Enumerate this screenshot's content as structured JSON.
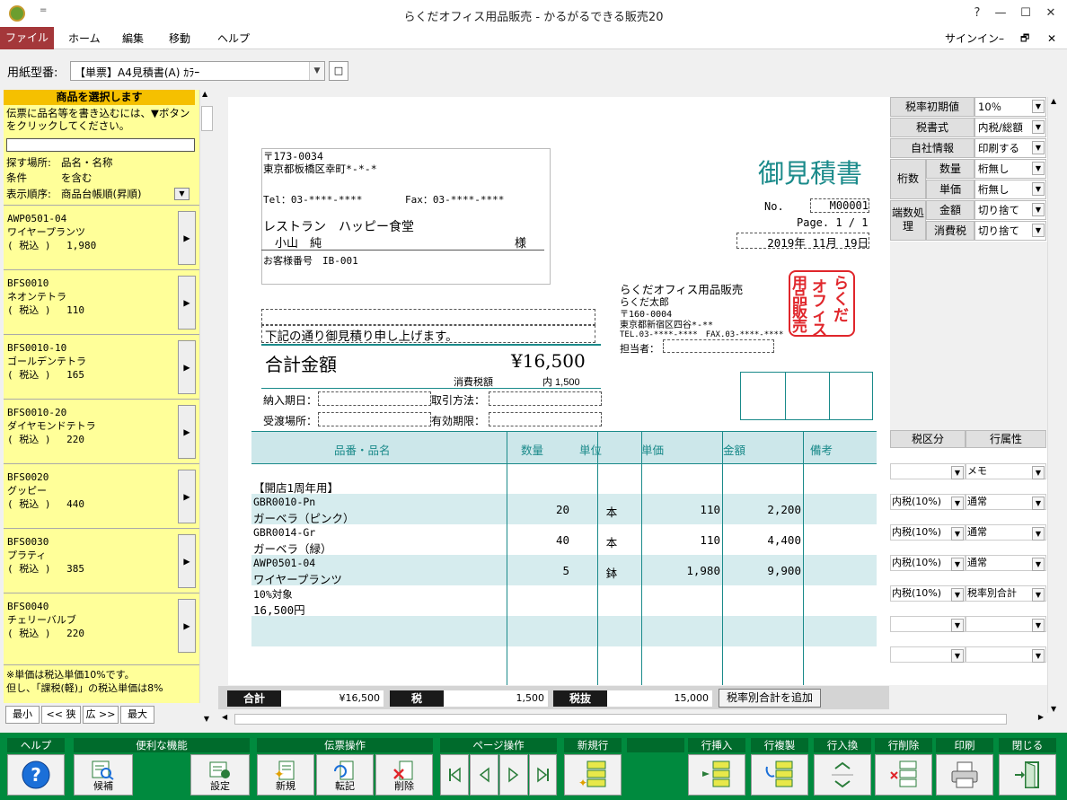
{
  "window": {
    "title": "らくだオフィス用品販売 - かるがるできる販売20",
    "help": "?",
    "min": "—",
    "max": "☐",
    "close": "✕",
    "qat": "="
  },
  "ribbon": {
    "file": "ファイル",
    "tabs": [
      "ホーム",
      "編集",
      "移動",
      "ヘルプ"
    ],
    "signin": "サインイン",
    "min": "–",
    "restore": "🗗",
    "close": "✕"
  },
  "toolbar": {
    "label": "用紙型番:",
    "form_value": "【単票】A4見積書(A) ｶﾗｰ",
    "btn": "□"
  },
  "left": {
    "header": "商品を選択します",
    "instruction": "伝票に品名等を書き込むには、▼ボタンをクリックしてください。",
    "search_value": "",
    "place_label": "探す場所:",
    "place_value": "品名・名称",
    "cond_label": "条件",
    "cond_value": "を含む",
    "order_label": "表示順序:",
    "order_value": "商品台帳順(昇順)",
    "items": [
      {
        "code": "AWP0501-04",
        "name": "ワイヤープランツ",
        "price": "( 税込 )　 1,980"
      },
      {
        "code": "BFS0010",
        "name": "ネオンテトラ",
        "price": "( 税込 )　 110"
      },
      {
        "code": "BFS0010-10",
        "name": "ゴールデンテトラ",
        "price": "( 税込 )　 165"
      },
      {
        "code": "BFS0010-20",
        "name": "ダイヤモンドテトラ",
        "price": "( 税込 )　 220"
      },
      {
        "code": "BFS0020",
        "name": "グッピー",
        "price": "( 税込 )　 440"
      },
      {
        "code": "BFS0030",
        "name": "プラティ",
        "price": "( 税込 )　 385"
      },
      {
        "code": "BFS0040",
        "name": "チェリーバルブ",
        "price": "( 税込 )　 220"
      }
    ],
    "note1": "※単価は税込単価10%です。",
    "note2": "但し、「課税(軽)」の税込単価は8%",
    "btns": [
      "最小",
      "<< 狭",
      "広 >>",
      "最大"
    ]
  },
  "doc": {
    "zip": "〒173-0034",
    "addr": "東京都板橋区幸町*-*-*",
    "tel": "Tel：03-****-****",
    "fax": "Fax：03-****-****",
    "customer": "レストラン　ハッピー食堂",
    "person": "小山　純",
    "sama": "様",
    "custno": "お客様番号　IB-001",
    "title": "御見積書",
    "no_label": "No.",
    "no_value": "M00001",
    "page": "Page. 1 / 1",
    "date": "2019年 11月 19日",
    "co_name": "らくだオフィス用品販売",
    "co_person": "らくだ太郎",
    "co_zip": "〒160-0004",
    "co_addr": "東京都新宿区四谷*-**",
    "co_tel": "TEL.03-****-****　FAX.03-****-****",
    "tanto": "担当者：",
    "stamp": [
      "用",
      "品",
      "販",
      "売",
      "オ",
      "フ",
      "ィ",
      "ス",
      "ら",
      "く",
      "だ"
    ],
    "lead": "下記の通り御見積り申し上げます。",
    "total_label": "合計金額",
    "total_value": "¥16,500",
    "tax_label": "消費税額",
    "tax_value": "内 1,500",
    "delivery": "納入期日：",
    "payment": "取引方法：",
    "place": "受渡場所：",
    "valid": "有効期限：",
    "cols": [
      "品番・品名",
      "数量",
      "単位",
      "単価",
      "金額",
      "備考"
    ],
    "rows": [
      {
        "code": "",
        "name": "【開店1周年用】",
        "qty": "",
        "unit": "",
        "price": "",
        "amount": ""
      },
      {
        "code": "GBR0010-Pn",
        "name": "ガーベラ（ピンク）",
        "qty": "20",
        "unit": "本",
        "price": "110",
        "amount": "2,200"
      },
      {
        "code": "GBR0014-Gr",
        "name": "ガーベラ（緑）",
        "qty": "40",
        "unit": "本",
        "price": "110",
        "amount": "4,400"
      },
      {
        "code": "AWP0501-04",
        "name": "ワイヤープランツ",
        "qty": "5",
        "unit": "鉢",
        "price": "1,980",
        "amount": "9,900"
      },
      {
        "code": "10%対象",
        "name": "16,500円",
        "qty": "",
        "unit": "",
        "price": "",
        "amount": ""
      }
    ]
  },
  "right": {
    "taxrate_label": "税率初期値",
    "taxrate_value": "10％",
    "taxtype_label": "税書式",
    "taxtype_value": "内税/総額",
    "company_label": "自社情報",
    "company_value": "印刷する",
    "digits_label": "桁数",
    "qty_label": "数量",
    "qty_value": "桁無し",
    "unit_label": "単価",
    "unit_value": "桁無し",
    "round_label": "端数処理",
    "amount_label": "金額",
    "amount_value": "切り捨て",
    "ctax_label": "消費税",
    "ctax_value": "切り捨て",
    "col_tax": "税区分",
    "col_attr": "行属性",
    "rows": [
      {
        "tax": "",
        "attr": "メモ"
      },
      {
        "tax": "内税(10%)",
        "attr": "通常"
      },
      {
        "tax": "内税(10%)",
        "attr": "通常"
      },
      {
        "tax": "内税(10%)",
        "attr": "通常"
      },
      {
        "tax": "内税(10%)",
        "attr": "税率別合計"
      },
      {
        "tax": "",
        "attr": ""
      },
      {
        "tax": "",
        "attr": ""
      }
    ]
  },
  "totals": {
    "sum_label": "合計",
    "sum_value": "¥16,500",
    "tax_label": "税",
    "tax_value": "1,500",
    "net_label": "税抜",
    "net_value": "15,000",
    "add_btn": "税率別合計を追加"
  },
  "bottom": {
    "help": "ヘルプ",
    "tools": "便利な機能",
    "candidate": "候補",
    "settings": "設定",
    "slip": "伝票操作",
    "new": "新規",
    "post": "転記",
    "delete": "削除",
    "pageop": "ページ操作",
    "newrow": "新規行",
    "insrow": "行挿入",
    "duprow": "行複製",
    "swaprow": "行入換",
    "delrow": "行削除",
    "print": "印刷",
    "close": "閉じる"
  },
  "colors": {
    "accent": "#1a8a8a",
    "ribbon_file": "#a4373a",
    "bottom": "#008a3e",
    "stamp": "#e0262b"
  }
}
